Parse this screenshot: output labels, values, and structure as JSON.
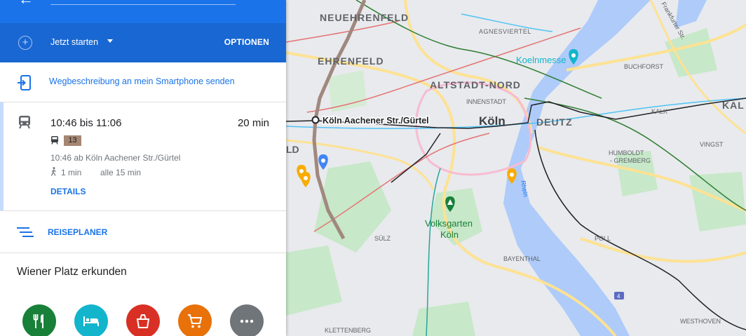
{
  "directions": {
    "start": {
      "label": "Jetzt starten"
    },
    "options_label": "OPTIONEN",
    "send_to_phone": "Wegbeschreibung an mein Smartphone senden",
    "route": {
      "time_range": "10:46 bis 11:06",
      "duration": "20 min",
      "line": "13",
      "departure": "10:46 ab Köln Aachener Str./Gürtel",
      "walk": "1 min",
      "frequency": "alle 15 min",
      "details": "DETAILS"
    },
    "planner_label": "REISEPLANER"
  },
  "explore": {
    "title": "Wiener Platz erkunden",
    "categories": [
      {
        "icon": "restaurant-icon",
        "color": "#188038"
      },
      {
        "icon": "hotel-icon",
        "color": "#12b5cb"
      },
      {
        "icon": "takeout-icon",
        "color": "#d93025"
      },
      {
        "icon": "shopping-cart-icon",
        "color": "#e8710a"
      },
      {
        "icon": "more-icon",
        "color": "#70757a"
      }
    ]
  },
  "map": {
    "labels": {
      "neuehrenfeld": "NEUEHRENFELD",
      "ehrenfeld": "EHRENFELD",
      "agnesviertel": "AGNESVIERTEL",
      "koelnmesse": "Koelnmesse",
      "buchforst": "BUCHFORST",
      "altstadt_nord": "ALTSTADT-NORD",
      "innenstadt": "INNENSTADT",
      "koeln": "Köln",
      "deutz": "DEUTZ",
      "kalk_small": "KALK",
      "kalk_large": "KAL",
      "humboldt_gremberg_1": "HUMBOLDT",
      "humboldt_gremberg_2": "- GREMBERG",
      "vingst": "VINGST",
      "station": "Köln Aachener Str./Gürtel",
      "ld": "LD",
      "rhein": "Rhein",
      "volksgarten_1": "Volksgarten",
      "volksgarten_2": "Köln",
      "suelz": "SÜLZ",
      "bayenthal": "BAYENTHAL",
      "poll": "POLL",
      "klettenberg": "KLETTENBERG",
      "westhoven": "WESTHOVEN",
      "frankfurter_str": "Frankfurter Str.",
      "highway": "4"
    },
    "colors": {
      "water": "#aecbfa",
      "park": "#c7e8c9",
      "major_road": "#fde293",
      "transit": "#e57373"
    }
  }
}
